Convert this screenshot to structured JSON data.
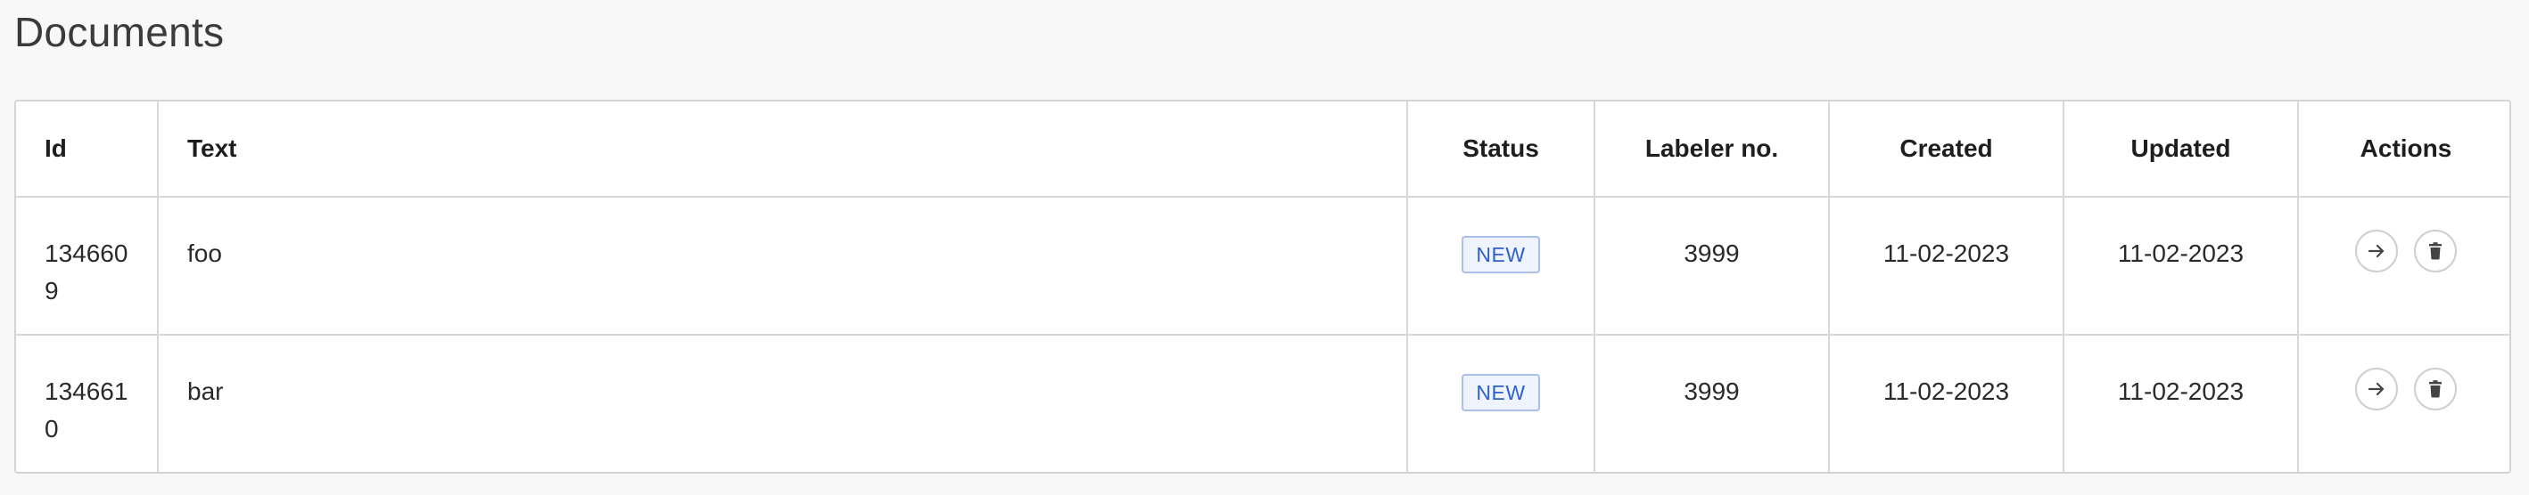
{
  "page": {
    "title": "Documents"
  },
  "table": {
    "columns": {
      "id": "Id",
      "text": "Text",
      "status": "Status",
      "labeler": "Labeler no.",
      "created": "Created",
      "updated": "Updated",
      "actions": "Actions"
    },
    "rows": [
      {
        "id": "1346609",
        "text": "foo",
        "status": "NEW",
        "labeler": "3999",
        "created": "11-02-2023",
        "updated": "11-02-2023"
      },
      {
        "id": "1346610",
        "text": "bar",
        "status": "NEW",
        "labeler": "3999",
        "created": "11-02-2023",
        "updated": "11-02-2023"
      }
    ]
  },
  "icons": {
    "open": "arrow-right-icon",
    "delete": "trash-icon"
  },
  "colors": {
    "badge_text": "#2f5fd0",
    "badge_bg": "#eef3fd",
    "badge_border": "#a9c0ee"
  }
}
